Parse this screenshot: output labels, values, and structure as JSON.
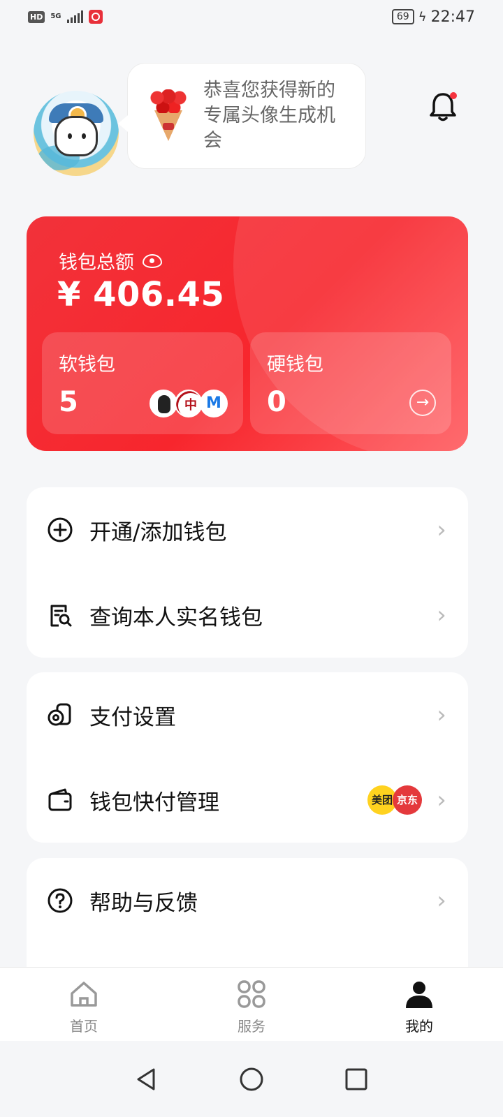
{
  "status_bar": {
    "hd": "HD",
    "network": "5G",
    "battery": "69",
    "time": "22:47"
  },
  "bubble": {
    "text": "恭喜您获得新的专属头像生成机会"
  },
  "wallet": {
    "total_label": "钱包总额",
    "total_amount": "¥ 406.45",
    "soft": {
      "label": "软钱包",
      "count": "5"
    },
    "hard": {
      "label": "硬钱包",
      "count": "0"
    }
  },
  "menu": {
    "group1": [
      {
        "label": "开通/添加钱包",
        "icon": "plus-circle-icon"
      },
      {
        "label": "查询本人实名钱包",
        "icon": "search-document-icon"
      }
    ],
    "group2": [
      {
        "label": "支付设置",
        "icon": "coins-icon"
      },
      {
        "label": "钱包快付管理",
        "icon": "wallet-icon",
        "badges": [
          "美团",
          "京东"
        ]
      }
    ],
    "group3": [
      {
        "label": "帮助与反馈",
        "icon": "question-circle-icon"
      }
    ]
  },
  "tabs": [
    {
      "label": "首页",
      "icon": "home-icon"
    },
    {
      "label": "服务",
      "icon": "grid-icon"
    },
    {
      "label": "我的",
      "icon": "person-icon",
      "active": true
    }
  ],
  "colors": {
    "accent": "#f7262d",
    "background": "#f5f6f8"
  }
}
